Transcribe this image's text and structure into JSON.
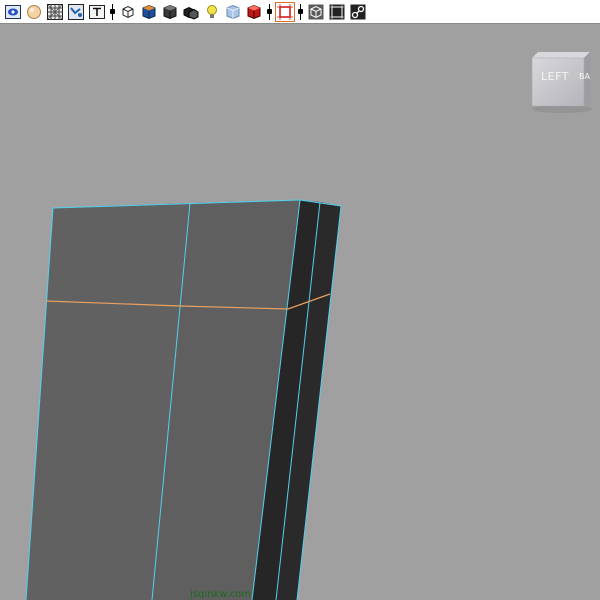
{
  "toolbar": {
    "buttons": [
      {
        "icon": "camera-view-icon"
      },
      {
        "icon": "lighting-sphere-icon"
      },
      {
        "icon": "wireframe-grid-icon"
      },
      {
        "icon": "uv-texture-icon"
      },
      {
        "icon": "text-t-icon"
      },
      {
        "icon": "wireframe-cube-icon"
      },
      {
        "icon": "smooth-shade-cube-icon"
      },
      {
        "icon": "flat-shade-cube-icon"
      },
      {
        "icon": "shadow-cube-icon"
      },
      {
        "icon": "light-bulb-icon"
      },
      {
        "icon": "xray-cube-icon"
      },
      {
        "icon": "red-cube-icon"
      },
      {
        "icon": "frame-selection-icon"
      },
      {
        "icon": "isolate-cube-icon"
      },
      {
        "icon": "resolution-gate-icon"
      },
      {
        "icon": "link-chain-icon"
      }
    ]
  },
  "viewcube": {
    "face_label": "LEFT",
    "side_label": "BA"
  },
  "colors": {
    "viewport_bg": "#a0a0a0",
    "front_face": "#616161",
    "side_face": "#262626",
    "edge_highlight": "#4fd2ee",
    "edge_loop": "#e8a060"
  },
  "watermark": {
    "text": "jsqinkw.com"
  }
}
